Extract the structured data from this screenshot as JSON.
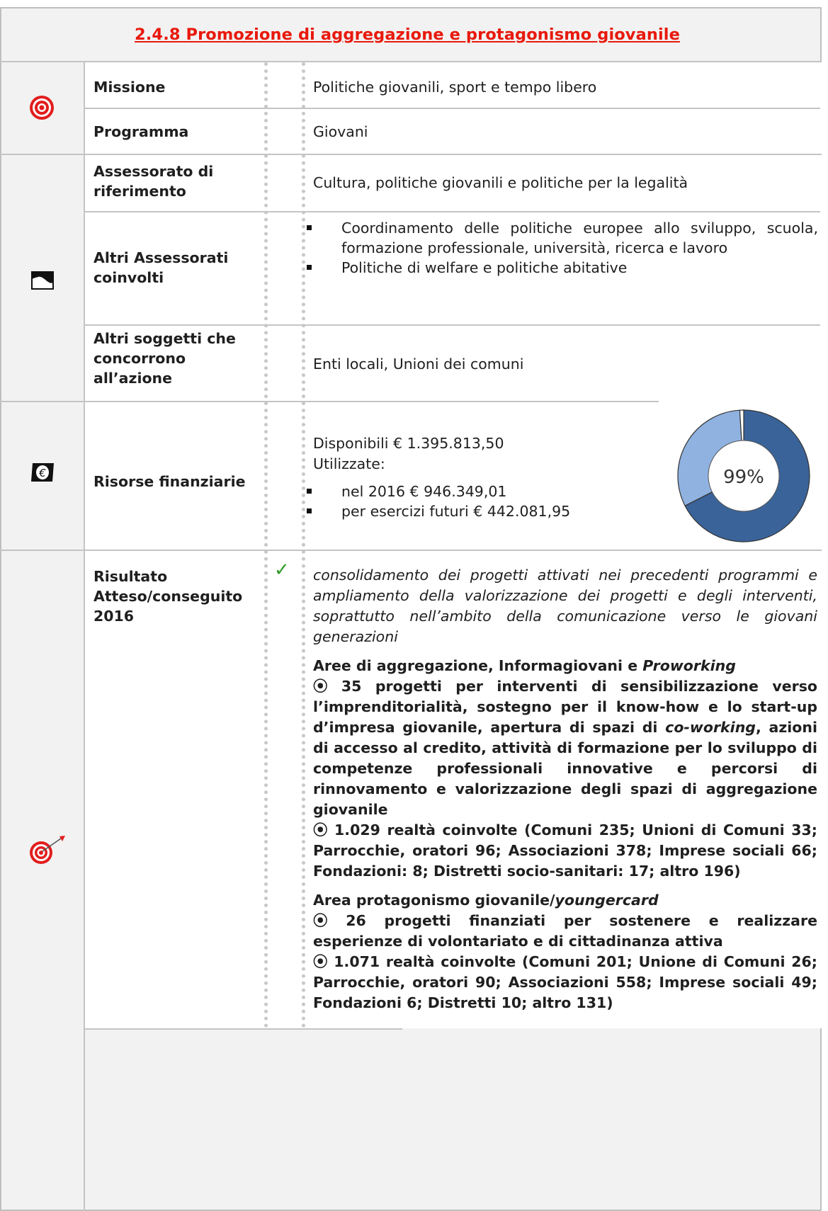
{
  "title": "2.4.8 Promozione di aggregazione e protagonismo giovanile",
  "rows": {
    "missione": {
      "label": "Missione",
      "value": "Politiche giovanili, sport e tempo libero"
    },
    "programma": {
      "label": "Programma",
      "value": "Giovani"
    },
    "assessorato": {
      "label_l1": "Assessorato di",
      "label_l2": "riferimento",
      "value": "Cultura, politiche giovanili e politiche per la legalità"
    },
    "altri_assessorati": {
      "label_l1": "Altri Assessorati",
      "label_l2": "coinvolti",
      "items": [
        "Coordinamento delle politiche europee allo sviluppo, scuola, formazione professionale, università, ricerca e lavoro",
        "Politiche di welfare e politiche abitative"
      ]
    },
    "altri_soggetti": {
      "label_l1": "Altri soggetti che",
      "label_l2": "concorrono",
      "label_l3": "all’azione",
      "value": "Enti locali, Unioni dei comuni"
    },
    "risorse": {
      "label": "Risorse finanziarie",
      "disponibili": "Disponibili € 1.395.813,50",
      "utilizzate": "Utilizzate:",
      "items": [
        "nel 2016 € 946.349,01",
        "per esercizi futuri € 442.081,95"
      ]
    },
    "risultato": {
      "label_l1": "Risultato",
      "label_l2": "Atteso/conseguito",
      "label_l3": "2016",
      "check": "✓",
      "intro": "consolidamento dei progetti attivati nei precedenti programmi e ampliamento della valorizzazione dei progetti e degli interventi, soprattutto nell’ambito della comunicazione verso le giovani generazioni",
      "area1_title_a": "Aree di aggregazione, Informagiovani e ",
      "area1_title_b": "Proworking",
      "area1_p1_a": "⦿ 35 progetti per interventi di sensibilizzazione verso l’imprenditorialità, sostegno per il know-how e lo start-up d’impresa giovanile, apertura di spazi di ",
      "area1_p1_b": "co-working",
      "area1_p1_c": ", azioni di accesso al credito, attività di formazione per lo sviluppo di competenze professionali innovative e percorsi di rinnovamento e valorizzazione degli spazi di aggregazione giovanile",
      "area1_p2": "⦿ 1.029 realtà coinvolte (Comuni 235; Unioni di Comuni 33; Parrocchie, oratori 96; Associazioni 378; Imprese sociali 66; Fondazioni: 8; Distretti socio-sanitari: 17; altro 196)",
      "area2_title_a": "Area protagonismo giovanile/",
      "area2_title_b": "youngercard",
      "area2_p1": "⦿ 26 progetti finanziati per sostenere e realizzare esperienze di volontariato e di cittadinanza attiva",
      "area2_p2": "⦿ 1.071 realtà coinvolte (Comuni 201; Unione di Comuni 26; Parrocchie, oratori 90; Associazioni 558; Imprese sociali 49; Fondazioni 6; Distretti 10; altro 131)"
    }
  },
  "chart_data": {
    "type": "pie",
    "donut": true,
    "center_label": "99%",
    "slices": [
      {
        "label": "nel 2016",
        "value": 946349.01,
        "color": "#3a6399"
      },
      {
        "label": "per esercizi futuri",
        "value": 442081.95,
        "color": "#8fb2e0"
      },
      {
        "label": "",
        "value": 13382.54,
        "color": "#ffffff"
      }
    ]
  },
  "icons": {
    "target": "target-icon",
    "flag": "flag-icon",
    "euro": "euro-flag-icon",
    "dart": "target-dart-icon"
  }
}
